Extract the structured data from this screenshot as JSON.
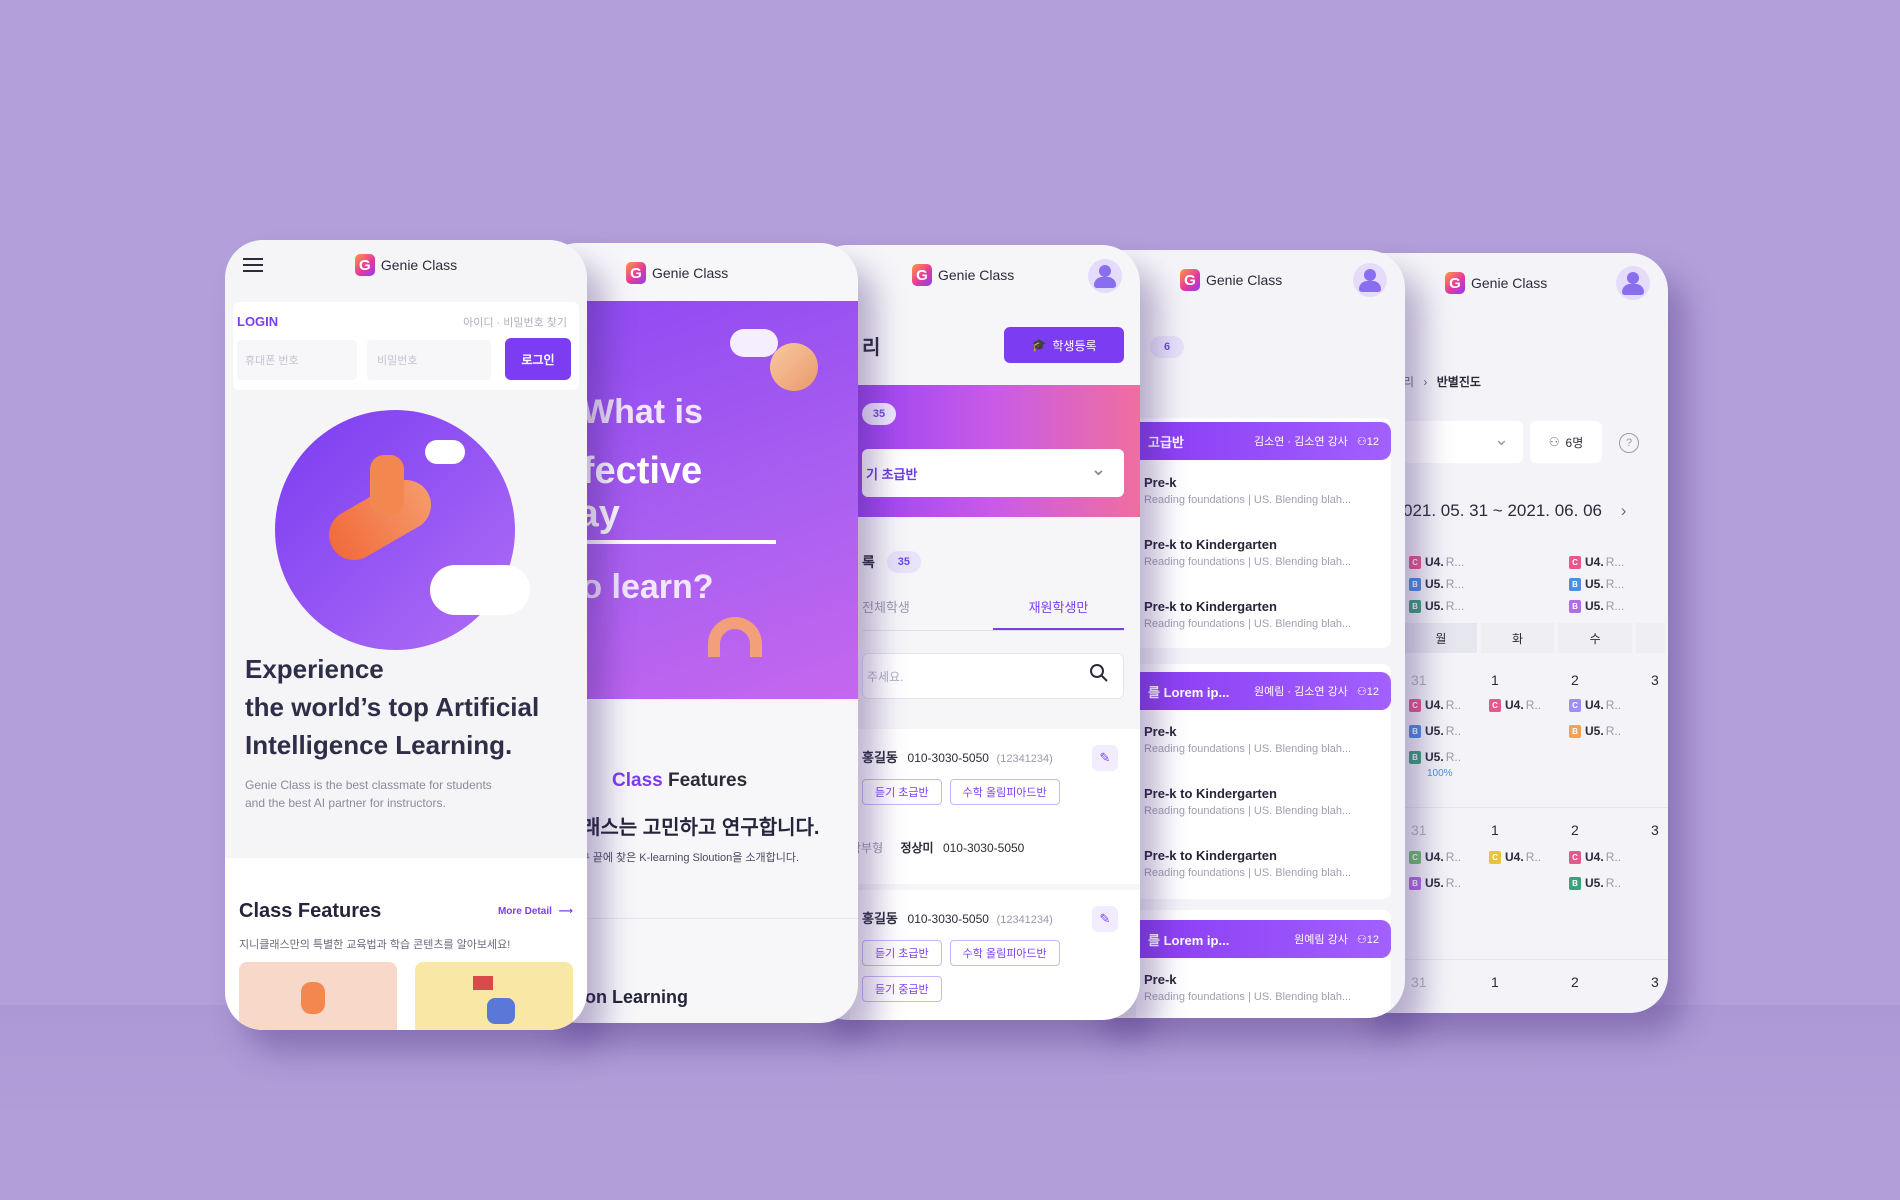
{
  "brand": {
    "name": "Genie Class"
  },
  "screen1": {
    "login_label": "LOGIN",
    "find_link": "아이디 · 비밀번호 찾기",
    "phone_placeholder": "휴대폰 번호",
    "password_placeholder": "비밀번호",
    "login_button": "로그인",
    "hero_line1": "Experience",
    "hero_line2": "the world’s top Artificial",
    "hero_line3": "Intelligence Learning.",
    "desc_line1": "Genie Class is the best classmate for students",
    "desc_line2": "and the best AI partner for instructors.",
    "features_title": "Class Features",
    "more_detail": "More Detail",
    "features_sub": "지니클래스만의 특별한 교육법과 학습 콘텐츠를 알아보세요!"
  },
  "screen2": {
    "q_line1": "What is",
    "q_line2": "effective way",
    "q_line3": "to learn?",
    "features_word1": "Class",
    "features_word2": "Features",
    "kr_headline": "래스는 고민하고 연구합니다.",
    "kr_sub": "¹ 끝에 찾은 K-learning Sloution을 소개합니다.",
    "bottom_text": "ion Learning"
  },
  "screen3": {
    "title_frag": "리",
    "register_button": "학생등록",
    "count_badge": "35",
    "select_value": "기 초급반",
    "list_frag": "록",
    "list_count": "35",
    "tab_all": "전체학생",
    "tab_enrolled": "재원학생만",
    "search_placeholder": "주세요.",
    "students": [
      {
        "name": "홍길동",
        "phone": "010-3030-5050",
        "id": "(12341234)",
        "chips": [
          "듣기 초급반",
          "수학 올림피아드반"
        ],
        "parent_label": "학부형",
        "parent_name": "정상미",
        "parent_phone": "010-3030-5050"
      },
      {
        "name": "홍길동",
        "phone": "010-3030-5050",
        "id": "(12341234)",
        "chips": [
          "듣기 초급반",
          "수학 올림피아드반",
          "듣기 중급반"
        ]
      }
    ]
  },
  "screen4": {
    "top_badge": "6",
    "groups": [
      {
        "title": "고급반",
        "teacher": "김소연 · 김소연 강사",
        "count": "12",
        "items": [
          {
            "title": "Pre-k",
            "sub": "Reading foundations |  US. Blending blah..."
          },
          {
            "title": "Pre-k to Kindergarten",
            "sub": "Reading foundations |  US. Blending blah..."
          },
          {
            "title": "Pre-k to Kindergarten",
            "sub": "Reading foundations |  US. Blending blah..."
          }
        ]
      },
      {
        "title": "를 Lorem ip...",
        "teacher": "원예림 · 김소연 강사",
        "count": "12",
        "items": [
          {
            "title": "Pre-k",
            "sub": "Reading foundations |  US. Blending blah..."
          },
          {
            "title": "Pre-k to Kindergarten",
            "sub": "Reading foundations |  US. Blending blah..."
          },
          {
            "title": "Pre-k to Kindergarten",
            "sub": "Reading foundations |  US. Blending blah..."
          }
        ]
      },
      {
        "title": "를 Lorem ip...",
        "teacher": "원예림 강사",
        "count": "12",
        "items": [
          {
            "title": "Pre-k",
            "sub": "Reading foundations |  US. Blending blah..."
          }
        ]
      }
    ]
  },
  "screen5": {
    "breadcrumb_prev": "리",
    "breadcrumb_current": "반별진도",
    "people_count": "6명",
    "date_range": "021. 05. 31 ~ 2021. 06. 06",
    "day_mon": "월",
    "day_tue": "화",
    "day_wed": "수",
    "progress_pct": "100%",
    "tag_u4": "U4.",
    "tag_u5": "U5.",
    "tag_r": "R...",
    "tag_r2": "R..",
    "num_31": "31",
    "num_1": "1",
    "num_2": "2",
    "num_3": "3",
    "colors": {
      "c": "#e8578a",
      "b_blue": "#4a8fe0",
      "b_green": "#3aa27a",
      "c_lav": "#9f8ef0",
      "b_orange": "#f0a15a",
      "c_green": "#6cc26a",
      "c_yellow": "#e9c33a",
      "b_purple": "#b36ae6"
    }
  }
}
